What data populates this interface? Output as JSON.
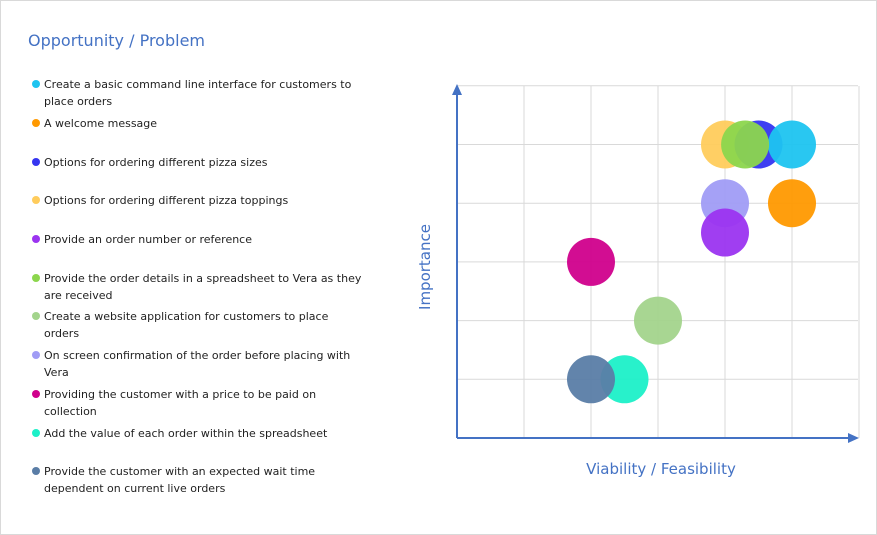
{
  "title": "Opportunity / Problem",
  "chart_data": {
    "type": "scatter",
    "xlabel": "Viability / Feasibility",
    "ylabel": "Importance",
    "xlim": [
      0,
      6
    ],
    "ylim": [
      0,
      6
    ],
    "grid": true,
    "legend_position": "left",
    "series": [
      {
        "name": "Create a basic command line interface for customers to place orders",
        "color": "#1ec4f0",
        "x": 5.0,
        "y": 5.0
      },
      {
        "name": "A welcome message",
        "color": "#ff9900",
        "x": 5.0,
        "y": 4.0
      },
      {
        "name": "Options for ordering different pizza sizes",
        "color": "#3535f0",
        "x": 4.5,
        "y": 5.0
      },
      {
        "name": "Options for ordering different pizza toppings",
        "color": "#ffcc5c",
        "x": 4.0,
        "y": 5.0
      },
      {
        "name": "Provide an order number or reference",
        "color": "#9b34f0",
        "x": 4.0,
        "y": 3.5
      },
      {
        "name": "Provide the order details in a spreadsheet to Vera as they are received",
        "color": "#8cd64d",
        "x": 4.3,
        "y": 5.0
      },
      {
        "name": "Create a website application for customers to place orders",
        "color": "#a3d48c",
        "x": 3.0,
        "y": 2.0
      },
      {
        "name": "On screen confirmation of the order before placing with Vera",
        "color": "#a09cf5",
        "x": 4.0,
        "y": 4.0
      },
      {
        "name": "Providing the customer with a price to be paid on collection",
        "color": "#d0008c",
        "x": 2.0,
        "y": 3.0
      },
      {
        "name": "Add the value of each order within the spreadsheet",
        "color": "#1cf0c8",
        "x": 2.5,
        "y": 1.0
      },
      {
        "name": "Provide the customer with an expected wait time dependent on current live orders",
        "color": "#5a7da6",
        "x": 2.0,
        "y": 1.0
      }
    ]
  }
}
